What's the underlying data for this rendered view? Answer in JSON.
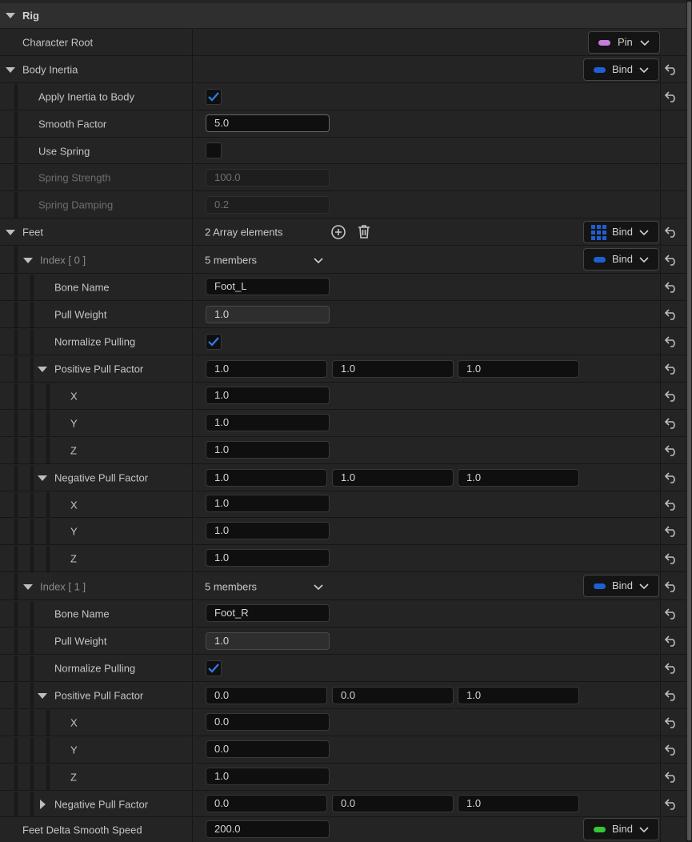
{
  "section": {
    "title": "Rig"
  },
  "character_root": {
    "label": "Character Root",
    "button": "Pin",
    "button_color": "#c77dde"
  },
  "body_inertia": {
    "label": "Body Inertia",
    "button": "Bind",
    "button_color": "#1f5fd4",
    "apply_inertia": {
      "label": "Apply Inertia to Body",
      "checked": true
    },
    "smooth_factor": {
      "label": "Smooth Factor",
      "value": "5.0"
    },
    "use_spring": {
      "label": "Use Spring",
      "checked": false
    },
    "spring_strength": {
      "label": "Spring Strength",
      "value": "100.0"
    },
    "spring_damping": {
      "label": "Spring Damping",
      "value": "0.2"
    }
  },
  "feet": {
    "label": "Feet",
    "count_text": "2 Array elements",
    "button": "Bind",
    "elements": [
      {
        "index_label": "Index [ 0 ]",
        "members_text": "5 members",
        "button": "Bind",
        "bone_name": {
          "label": "Bone Name",
          "value": "Foot_L"
        },
        "pull_weight": {
          "label": "Pull Weight",
          "value": "1.0"
        },
        "normalize": {
          "label": "Normalize Pulling",
          "checked": true
        },
        "positive": {
          "label": "Positive Pull Factor",
          "x": "1.0",
          "y": "1.0",
          "z": "1.0",
          "x_label": "X",
          "y_label": "Y",
          "z_label": "Z"
        },
        "negative": {
          "label": "Negative Pull Factor",
          "x": "1.0",
          "y": "1.0",
          "z": "1.0",
          "x_label": "X",
          "y_label": "Y",
          "z_label": "Z"
        }
      },
      {
        "index_label": "Index [ 1 ]",
        "members_text": "5 members",
        "button": "Bind",
        "bone_name": {
          "label": "Bone Name",
          "value": "Foot_R"
        },
        "pull_weight": {
          "label": "Pull Weight",
          "value": "1.0"
        },
        "normalize": {
          "label": "Normalize Pulling",
          "checked": true
        },
        "positive": {
          "label": "Positive Pull Factor",
          "x": "0.0",
          "y": "0.0",
          "z": "1.0",
          "x_label": "X",
          "y_label": "Y",
          "z_label": "Z"
        },
        "negative": {
          "label": "Negative Pull Factor",
          "x": "0.0",
          "y": "0.0",
          "z": "1.0"
        }
      }
    ]
  },
  "feet_delta": {
    "label": "Feet Delta Smooth Speed",
    "value": "200.0",
    "button": "Bind",
    "button_color": "#35c735"
  },
  "colors": {
    "check_blue": "#2f7fe8",
    "bind_blue": "#1f5fd4"
  }
}
